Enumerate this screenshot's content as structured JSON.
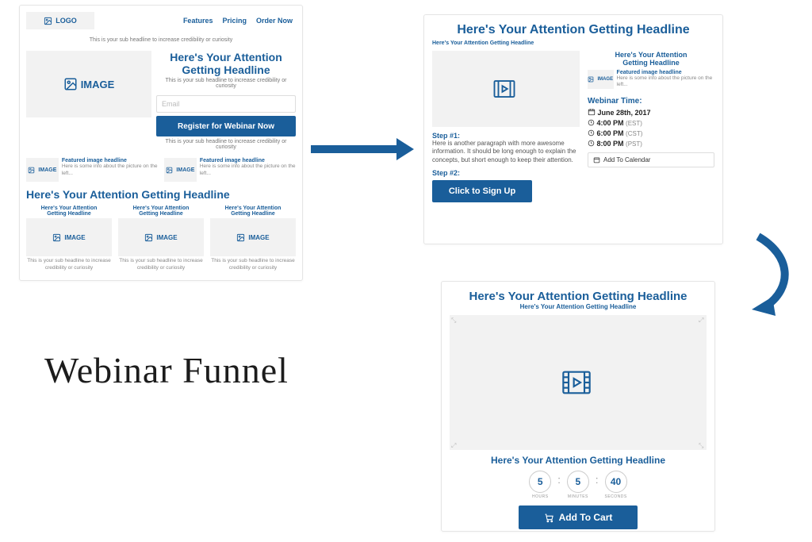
{
  "label": "Webinar Funnel",
  "common": {
    "headline": "Here's Your Attention Getting Headline",
    "image_ph": "IMAGE",
    "sub_headline_tiny": "This is your sub headline to increase credibility or curiosity"
  },
  "p1": {
    "logo": "LOGO",
    "nav": [
      "Features",
      "Pricing",
      "Order Now"
    ],
    "email_ph": "Email",
    "register_btn": "Register for Webinar Now",
    "feat_title": "Featured image headline",
    "feat_body": "Here is some info about the picture on the left...",
    "bottom_sub": "This is your sub headline to increase credibility or curiosity"
  },
  "p2": {
    "step1_label": "Step #1:",
    "step1_body": "Here is another paragraph with more awesome information. It should be long enough to explain the concepts, but short enough to keep their attention.",
    "step2_label": "Step #2:",
    "signup_btn": "Click to Sign Up",
    "feat_title": "Featured image headline",
    "feat_body": "Here is some info about the picture on the left...",
    "wt_label": "Webinar Time:",
    "date": "June 28th, 2017",
    "times": [
      {
        "t": "4:00 PM",
        "z": "(EST)"
      },
      {
        "t": "6:00 PM",
        "z": "(CST)"
      },
      {
        "t": "8:00 PM",
        "z": "(PST)"
      }
    ],
    "cal": "Add To Calendar"
  },
  "p3": {
    "count": {
      "h": "5",
      "m": "5",
      "s": "40"
    },
    "labels": {
      "h": "HOURS",
      "m": "MINUTES",
      "s": "SECONDS"
    },
    "cart_btn": "Add To Cart"
  }
}
